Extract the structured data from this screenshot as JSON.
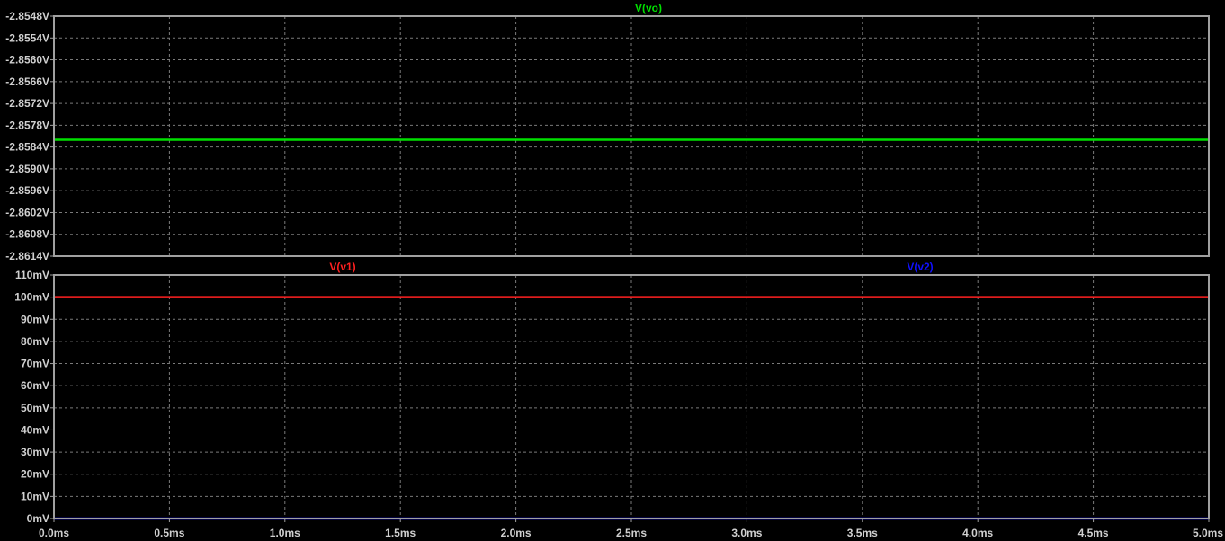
{
  "chart_data": [
    {
      "type": "line",
      "panel": "top",
      "background": "#000000",
      "frame_color": "#a0a0a0",
      "grid": true,
      "grid_style": "dashed",
      "x": [
        0,
        5
      ],
      "xlim": [
        0,
        5
      ],
      "ylim": [
        -2.8614,
        -2.8548
      ],
      "yticks": [
        -2.8548,
        -2.8554,
        -2.856,
        -2.8566,
        -2.8572,
        -2.8578,
        -2.8584,
        -2.859,
        -2.8596,
        -2.8602,
        -2.8608,
        -2.8614
      ],
      "ytick_labels": [
        "-2.8548V",
        "-2.8554V",
        "-2.8560V",
        "-2.8566V",
        "-2.8572V",
        "-2.8578V",
        "-2.8584V",
        "-2.8590V",
        "-2.8596V",
        "-2.8602V",
        "-2.8608V",
        "-2.8614V"
      ],
      "series": [
        {
          "name": "V(vo)",
          "color": "#00e000",
          "x": [
            0,
            5
          ],
          "values": [
            -2.8582,
            -2.8582
          ]
        }
      ]
    },
    {
      "type": "line",
      "panel": "bottom",
      "background": "#000000",
      "frame_color": "#a0a0a0",
      "grid": true,
      "grid_style": "dashed",
      "xlim": [
        0,
        5
      ],
      "ylim": [
        0,
        110
      ],
      "xticks": [
        0,
        0.5,
        1,
        1.5,
        2,
        2.5,
        3,
        3.5,
        4,
        4.5,
        5
      ],
      "xtick_labels": [
        "0.0ms",
        "0.5ms",
        "1.0ms",
        "1.5ms",
        "2.0ms",
        "2.5ms",
        "3.0ms",
        "3.5ms",
        "4.0ms",
        "4.5ms",
        "5.0ms"
      ],
      "yticks": [
        110,
        100,
        90,
        80,
        70,
        60,
        50,
        40,
        30,
        20,
        10,
        0
      ],
      "ytick_labels": [
        "110mV",
        "100mV",
        "90mV",
        "80mV",
        "70mV",
        "60mV",
        "50mV",
        "40mV",
        "30mV",
        "20mV",
        "10mV",
        "0mV"
      ],
      "series": [
        {
          "name": "V(v1)",
          "color": "#ff2020",
          "x": [
            0,
            5
          ],
          "values": [
            100,
            100
          ]
        },
        {
          "name": "V(v2)",
          "color": "#1010ff",
          "x": [
            0,
            5
          ],
          "values": [
            0,
            0
          ]
        }
      ]
    }
  ]
}
